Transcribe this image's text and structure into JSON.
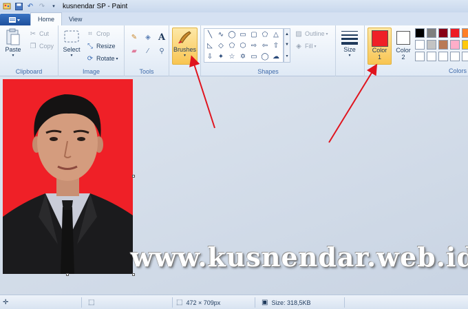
{
  "window": {
    "title": "kusnendar SP - Paint"
  },
  "tabs": {
    "home": "Home",
    "view": "View"
  },
  "ribbon": {
    "clipboard": {
      "label": "Clipboard",
      "paste": "Paste",
      "cut": "Cut",
      "copy": "Copy"
    },
    "image": {
      "label": "Image",
      "select": "Select",
      "crop": "Crop",
      "resize": "Resize",
      "rotate": "Rotate"
    },
    "tools": {
      "label": "Tools"
    },
    "brushes": "Brushes",
    "shapes": {
      "label": "Shapes",
      "outline": "Outline",
      "fill": "Fill"
    },
    "size": "Size",
    "colors": {
      "color1_line1": "Color",
      "color1_line2": "1",
      "color2_line1": "Color",
      "color2_line2": "2",
      "label": "Colors",
      "color1_value": "#ef2027",
      "color2_value": "#ffffff",
      "palette": [
        "#000000",
        "#7f7f7f",
        "#880015",
        "#ed1c24",
        "#ff7f27",
        "#ffffff",
        "#c3c3c3",
        "#b97a57",
        "#ffaec9",
        "#ffc90e",
        "#ffffff",
        "#ffffff",
        "#ffffff",
        "#ffffff",
        "#ffffff"
      ]
    }
  },
  "canvas": {
    "background_color": "#ef2027",
    "watermark": "www.kusnendar.web.id"
  },
  "statusbar": {
    "dimensions": "472 × 709px",
    "size": "Size: 318,5KB"
  }
}
